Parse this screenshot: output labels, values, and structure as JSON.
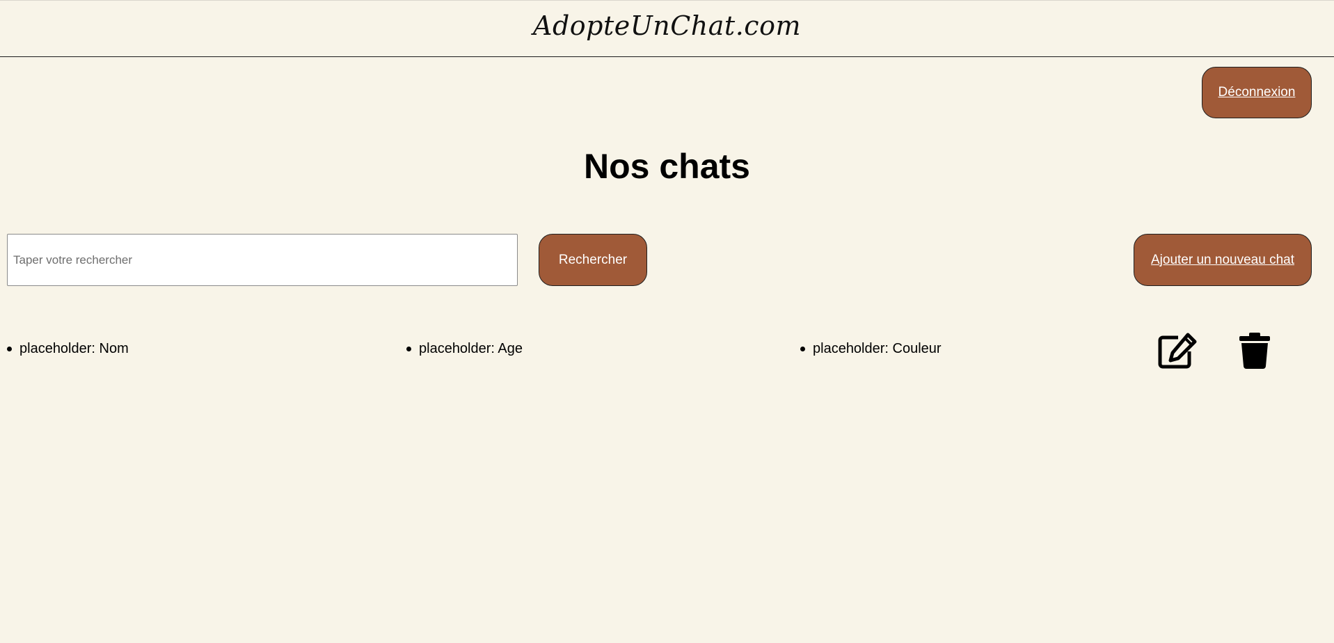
{
  "header": {
    "logo_text": "AdopteUnChat.com"
  },
  "auth": {
    "logout_label": "Déconnexion"
  },
  "main": {
    "title": "Nos chats"
  },
  "search": {
    "placeholder": "Taper votre rechercher",
    "value": "",
    "button_label": "Rechercher"
  },
  "actions": {
    "add_label": "Ajouter un nouveau chat"
  },
  "cats": [
    {
      "nom": "placeholder: Nom",
      "age": "placeholder: Age",
      "couleur": "placeholder: Couleur",
      "edit_icon": "edit-icon",
      "delete_icon": "trash-icon"
    }
  ],
  "colors": {
    "background": "#f8f4e8",
    "button": "#a05a38",
    "button_text": "#ffffff"
  }
}
